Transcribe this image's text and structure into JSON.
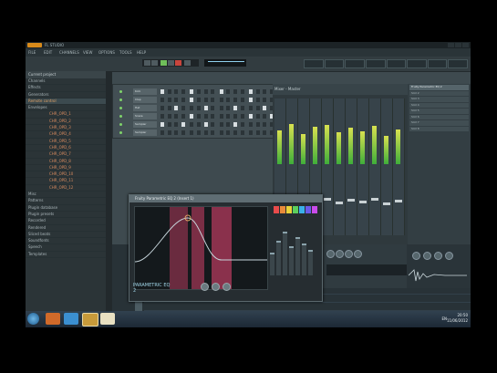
{
  "window": {
    "title": "FL STUDIO"
  },
  "menus": [
    "FILE",
    "EDIT",
    "CHANNELS",
    "VIEW",
    "OPTIONS",
    "TOOLS",
    "HELP"
  ],
  "browser": {
    "header": "Current project",
    "items": [
      {
        "label": "Channels",
        "type": "folder"
      },
      {
        "label": "Effects",
        "type": "folder"
      },
      {
        "label": "Generators",
        "type": "folder"
      },
      {
        "label": "Remote control",
        "type": "folder"
      },
      {
        "label": "Envelopes",
        "type": "folder"
      },
      {
        "label": "Misc",
        "type": "folder"
      },
      {
        "label": "Patterns",
        "type": "folder"
      },
      {
        "label": "Plugin database",
        "type": "folder"
      },
      {
        "label": "Plugin presets",
        "type": "folder"
      },
      {
        "label": "Recorded",
        "type": "folder"
      },
      {
        "label": "Rendered",
        "type": "folder"
      },
      {
        "label": "Sliced beats",
        "type": "folder"
      },
      {
        "label": "Soundfonts",
        "type": "folder"
      },
      {
        "label": "Speech",
        "type": "folder"
      },
      {
        "label": "Templates",
        "type": "folder"
      }
    ],
    "files": [
      "CHR_OPD_1",
      "CHR_OPD_2",
      "CHR_OPD_3",
      "CHR_OPD_4",
      "CHR_OPD_5",
      "CHR_OPD_6",
      "CHR_OPD_7",
      "CHR_OPD_8",
      "CHR_OPD_9",
      "CHR_OPD_10",
      "CHR_OPD_11",
      "CHR_OPD_12"
    ]
  },
  "channels": [
    {
      "name": "Kick",
      "steps": [
        1,
        0,
        0,
        0,
        1,
        0,
        0,
        0,
        1,
        0,
        0,
        0,
        1,
        0,
        0,
        0
      ]
    },
    {
      "name": "Clap",
      "steps": [
        0,
        0,
        0,
        0,
        1,
        0,
        0,
        0,
        0,
        0,
        0,
        0,
        1,
        0,
        0,
        0
      ]
    },
    {
      "name": "Hat",
      "steps": [
        0,
        0,
        1,
        0,
        0,
        0,
        1,
        0,
        0,
        0,
        1,
        0,
        0,
        0,
        1,
        0
      ]
    },
    {
      "name": "Snare",
      "steps": [
        0,
        0,
        0,
        0,
        1,
        0,
        0,
        0,
        0,
        0,
        0,
        0,
        1,
        0,
        0,
        1
      ]
    },
    {
      "name": "Sampler",
      "steps": [
        1,
        0,
        0,
        1,
        0,
        0,
        1,
        0,
        0,
        0,
        1,
        0,
        0,
        0,
        0,
        0
      ]
    },
    {
      "name": "Sampler",
      "steps": [
        0,
        0,
        0,
        0,
        0,
        0,
        0,
        0,
        0,
        0,
        0,
        0,
        0,
        0,
        0,
        0
      ]
    }
  ],
  "mixer": {
    "title": "Mixer - Master",
    "levels": [
      0.62,
      0.74,
      0.55,
      0.68,
      0.71,
      0.58,
      0.66,
      0.6,
      0.7,
      0.52,
      0.64
    ]
  },
  "fx_panel": {
    "slots": [
      "Fruity Parametric EQ 2",
      "Slot 2",
      "Slot 3",
      "Slot 4",
      "Slot 5",
      "Slot 6",
      "Slot 7",
      "Slot 8"
    ]
  },
  "eq_window": {
    "title": "Fruity Parametric EQ 2 (Insert 1)",
    "brand": "PARAMETRIC EQ 2",
    "band_heights": [
      0.35,
      0.55,
      0.7,
      0.45,
      0.6,
      0.5,
      0.4
    ],
    "pad_colors": [
      "#e94b4b",
      "#e98b3a",
      "#e9d23a",
      "#5ccf5c",
      "#3ab0e9",
      "#6a5be9",
      "#c94be9"
    ]
  },
  "taskbar": {
    "time": "20:50",
    "date": "11/06/2012",
    "lang": "EN"
  },
  "colors": {
    "accent": "#e0a266",
    "eq_band": "#b13a5c",
    "meter": "#3fae3a"
  }
}
